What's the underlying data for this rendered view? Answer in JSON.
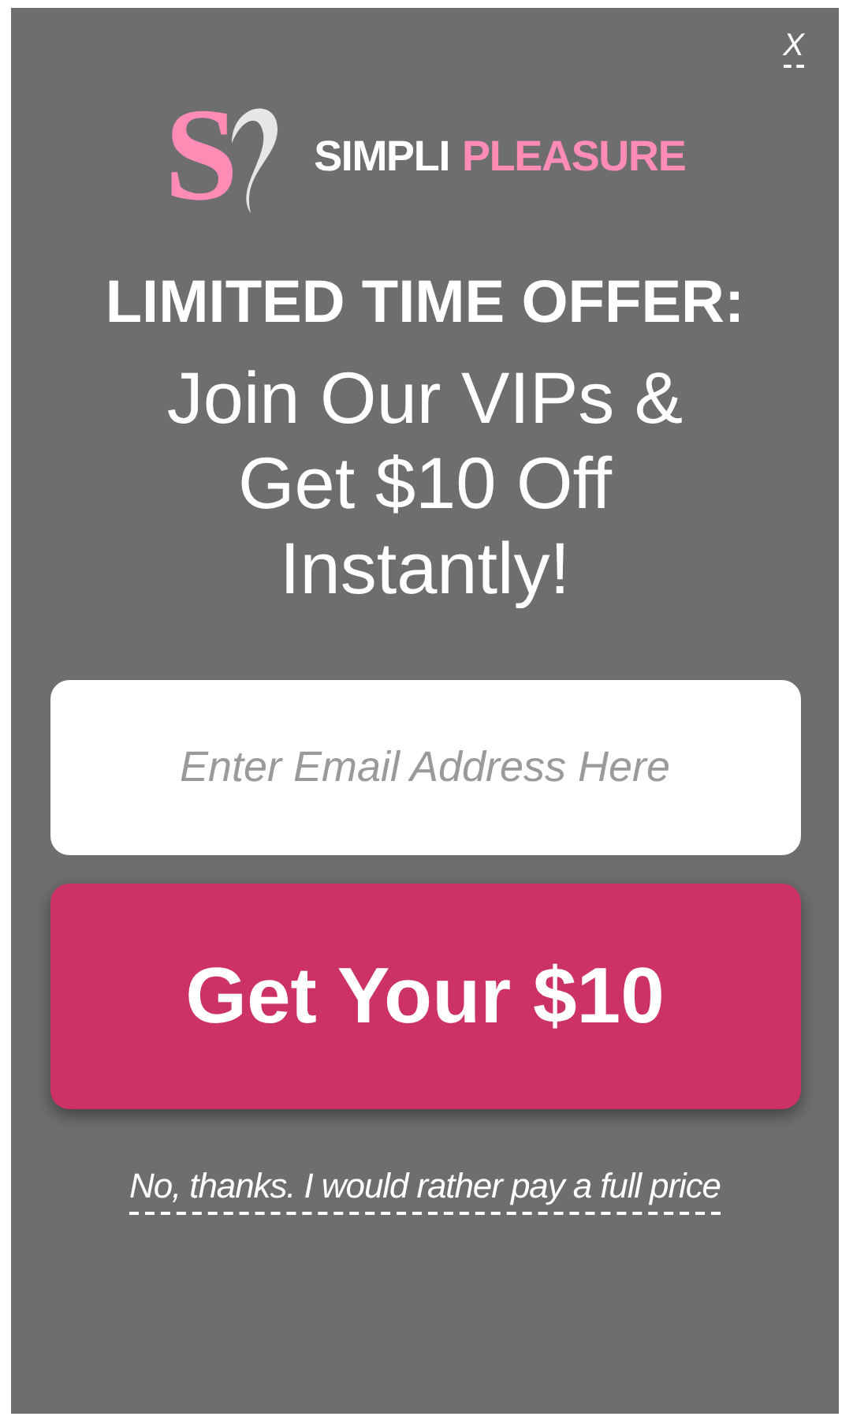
{
  "close_button": {
    "label": "X"
  },
  "logo": {
    "monogram": "S",
    "brand_first": "SIMPLI",
    "brand_second": "PLEASURE"
  },
  "headline": "LIMITED TIME OFFER:",
  "subheadline": "Join Our VIPs & Get $10 Off Instantly!",
  "email_field": {
    "placeholder": "Enter Email Address Here"
  },
  "submit_button": {
    "label": "Get Your $10"
  },
  "decline_link": {
    "label": "No, thanks. I would rather pay a full price"
  }
}
